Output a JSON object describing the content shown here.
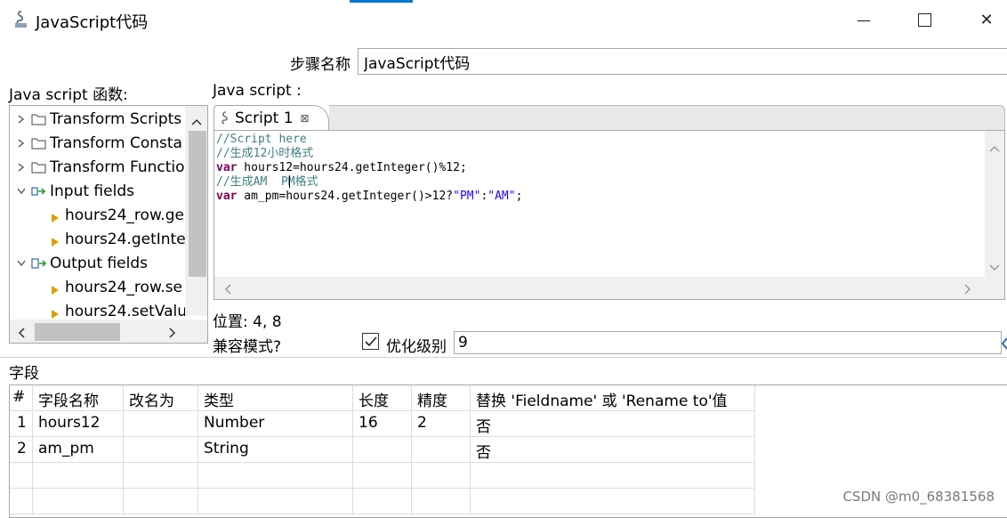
{
  "window": {
    "title": "JavaScript代码",
    "minimize_glyph": "—",
    "close_glyph": "✕"
  },
  "step": {
    "label": "步骤名称",
    "value": "JavaScript代码"
  },
  "functions_panel": {
    "label": "Java script 函数:",
    "items": [
      {
        "label": "Transform Scripts",
        "kind": "folder"
      },
      {
        "label": "Transform Consta",
        "kind": "folder"
      },
      {
        "label": "Transform Functio",
        "kind": "folder"
      },
      {
        "label": "Input fields",
        "kind": "input-node"
      },
      {
        "label": "hours24_row.ge",
        "kind": "leaf"
      },
      {
        "label": "hours24.getInte",
        "kind": "leaf"
      },
      {
        "label": "Output fields",
        "kind": "output-node"
      },
      {
        "label": "hours24_row.se",
        "kind": "leaf"
      },
      {
        "label": "hours24.setValu",
        "kind": "leaf"
      }
    ]
  },
  "script_panel": {
    "label": "Java script :",
    "tab_label": "Script 1",
    "tab_close": "⊠",
    "code_lines": {
      "l1": "//Script here",
      "l2": "//生成12小时格式",
      "l3_kw": "var",
      "l3_rest": " hours12=hours24.getInteger()%12;",
      "l4": "//生成AM  PM格式",
      "l5_kw": "var",
      "l5_mid": " am_pm=hours24.getInteger()>12?",
      "l5_s1": "\"PM\"",
      "l5_colon": ":",
      "l5_s2": "\"AM\"",
      "l5_end": ";"
    }
  },
  "position": {
    "label": "位置: 4, 8"
  },
  "compat": {
    "label": "兼容模式?"
  },
  "optimize": {
    "label": "优化级别",
    "checked": true,
    "value": "9"
  },
  "fields": {
    "label": "字段",
    "columns": [
      "#",
      "字段名称",
      "改名为",
      "类型",
      "长度",
      "精度",
      "替换 'Fieldname' 或 'Rename to'值"
    ],
    "rows": [
      [
        "1",
        "hours12",
        "",
        "Number",
        "16",
        "2",
        "否"
      ],
      [
        "2",
        "am_pm",
        "",
        "String",
        "",
        "",
        "否"
      ]
    ]
  },
  "watermark": "CSDN @m0_68381568",
  "colors": {
    "accent": "#0078d7",
    "keyword": "#7f0055",
    "comment": "#3f7f7f",
    "string": "#2a00ff"
  }
}
